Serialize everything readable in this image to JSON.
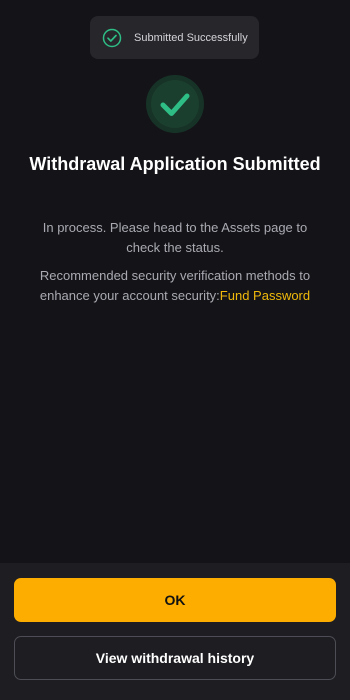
{
  "toast": {
    "icon": "check-circle-icon",
    "message": "Submitted Successfully"
  },
  "status": {
    "icon": "check-icon",
    "title": "Withdrawal Application Submitted",
    "subtitle": "In process. Please head to the Assets page to check the status.",
    "security_text": "Recommended security verification methods to enhance your account security:",
    "security_link": "Fund Password"
  },
  "actions": {
    "ok_label": "OK",
    "history_label": "View withdrawal history"
  },
  "colors": {
    "background": "#141418",
    "accent": "#fcad00",
    "success": "#2ebd85",
    "link": "#f0b90b"
  }
}
